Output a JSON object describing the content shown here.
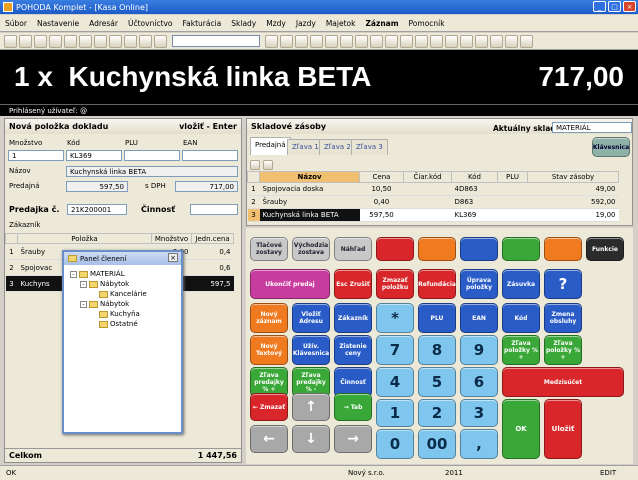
{
  "window": {
    "title": "POHODA Komplet - [Kasa Online]"
  },
  "menu": [
    "Súbor",
    "Nastavenie",
    "Adresár",
    "Účtovníctvo",
    "Fakturácia",
    "Sklady",
    "Mzdy",
    "Jazdy",
    "Majetok",
    "Záznam",
    "Pomocník"
  ],
  "display": {
    "quantity": "1 x",
    "item": "Kuchynská linka BETA",
    "price": "717,00"
  },
  "user_bar": "Prihlásený užívateľ: @",
  "left": {
    "header": "Nová položka dokladu",
    "header_right": "vložiť - Enter",
    "labels": {
      "mnozstvo": "Množstvo",
      "kod": "Kód",
      "plu": "PLU",
      "ean": "EAN",
      "nazov": "Názov",
      "predajna": "Predajná",
      "s_dph": "s DPH"
    },
    "mnozstvo": "1",
    "kod": "KL369",
    "nazov": "Kuchynská linka BETA",
    "predajna_value": "597,50",
    "s_dph_value": "717,00",
    "predajka_label": "Predajka č.",
    "predajka_value": "21K200001",
    "cinnost_label": "Činnosť",
    "zakaznik_label": "Zákazník",
    "table_headers": [
      "Položka",
      "Množstvo",
      "Jedn.cena"
    ],
    "rows": [
      {
        "n": "1",
        "name": "Šrauby",
        "qty": "2,00",
        "price": "0,4"
      },
      {
        "n": "2",
        "name": "Spojovac",
        "qty": "",
        "price": "0,6"
      },
      {
        "n": "3",
        "name": "Kuchyns",
        "qty": "",
        "price": "597,5"
      }
    ],
    "total_label": "Celkom",
    "total_value": "1 447,56"
  },
  "panel": {
    "title": "Panel členení",
    "tree": [
      {
        "label": "MATERIÁL",
        "level": 0
      },
      {
        "label": "Nábytok",
        "level": 1
      },
      {
        "label": "Kancelárie",
        "level": 2
      },
      {
        "label": "Nábytok",
        "level": 1
      },
      {
        "label": "Kuchyňa",
        "level": 2
      },
      {
        "label": "Ostatné",
        "level": 2
      }
    ]
  },
  "right": {
    "header": "Skladové zásoby",
    "sklad_label": "Aktuálny sklad",
    "sklad_value": "MATERIÁL",
    "tabs": [
      "Predajná",
      "Zľava 1",
      "Zľava 2",
      "Zľava 3"
    ],
    "klavesnica": "Klávesnica",
    "table_headers": [
      "Názov",
      "Cena",
      "Čiar.kód",
      "Kód",
      "PLU",
      "Stav zásoby"
    ],
    "rows": [
      {
        "n": "1",
        "name": "Spojovacia doska",
        "price": "10,50",
        "ckod": "",
        "kod": "4D863",
        "plu": "",
        "stav": "49,00"
      },
      {
        "n": "2",
        "name": "Šrauby",
        "price": "0,40",
        "ckod": "",
        "kod": "D863",
        "plu": "",
        "stav": "592,00"
      },
      {
        "n": "3",
        "name": "Kuchynská linka BETA",
        "price": "597,50",
        "ckod": "",
        "kod": "KL369",
        "plu": "",
        "stav": "19,00"
      }
    ]
  },
  "keys": {
    "tlacove": "Tlačové zostavy",
    "vychodzia": "Východzia zostava",
    "nahlad": "Náhľad",
    "funkcie": "Funkcie",
    "ukoncit": "Ukončiť predaj",
    "esc": "Esc Zrušiť",
    "zmazat_polozku": "Zmazať položku",
    "refundacia": "Refundácia",
    "uprava": "Úprava položky",
    "zasuvka": "Zásuvka",
    "help": "?",
    "novy_zaznam": "Nový záznam",
    "vlozit_adresu": "Vložiť Adresu",
    "zakaznik": "Zákazník",
    "star": "*",
    "plu": "PLU",
    "ean": "EAN",
    "kod": "Kód",
    "zmena_obsluhy": "Zmena obsluhy",
    "novy_textovy": "Nový Textový",
    "uziv_klavesnica": "Užív. Klávesnica",
    "zistenie_ceny": "Zistenie ceny",
    "zlava_polozky_plus": "Zľava položky % +",
    "zlava_predajky_plus": "Zľava predajky % +",
    "zlava_predajky_minus": "Zľava predajky % -",
    "cinnost": "Činnosť",
    "zlava_polozky_minus": "Zľava položky % -",
    "medzisucet": "Medzisúčet",
    "zmazat": "Zmazať",
    "tab": "Tab",
    "ok": "OK",
    "ulozit": "Uložiť",
    "digits": [
      "7",
      "8",
      "9",
      "4",
      "5",
      "6",
      "1",
      "2",
      "3",
      "0",
      "00",
      ","
    ]
  },
  "status": {
    "left": "OK",
    "company": "Nový s.r.o.",
    "year": "2011",
    "mode": "EDIT"
  },
  "colors": {
    "red": "#d8262a",
    "orange": "#f07a20",
    "blue": "#2a5cc8",
    "lightblue": "#7ec6ee",
    "green": "#3aa838",
    "gray": "#a8a8a8",
    "magenta": "#c83ca0",
    "black": "#111111"
  }
}
